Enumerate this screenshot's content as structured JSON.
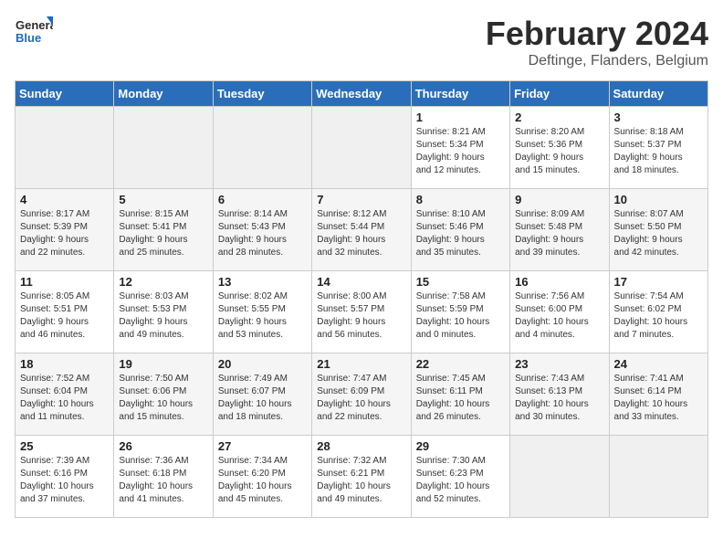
{
  "header": {
    "logo_text_general": "General",
    "logo_text_blue": "Blue",
    "month_year": "February 2024",
    "location": "Deftinge, Flanders, Belgium"
  },
  "weekdays": [
    "Sunday",
    "Monday",
    "Tuesday",
    "Wednesday",
    "Thursday",
    "Friday",
    "Saturday"
  ],
  "weeks": [
    [
      {
        "day": "",
        "data": ""
      },
      {
        "day": "",
        "data": ""
      },
      {
        "day": "",
        "data": ""
      },
      {
        "day": "",
        "data": ""
      },
      {
        "day": "1",
        "data": "Sunrise: 8:21 AM\nSunset: 5:34 PM\nDaylight: 9 hours\nand 12 minutes."
      },
      {
        "day": "2",
        "data": "Sunrise: 8:20 AM\nSunset: 5:36 PM\nDaylight: 9 hours\nand 15 minutes."
      },
      {
        "day": "3",
        "data": "Sunrise: 8:18 AM\nSunset: 5:37 PM\nDaylight: 9 hours\nand 18 minutes."
      }
    ],
    [
      {
        "day": "4",
        "data": "Sunrise: 8:17 AM\nSunset: 5:39 PM\nDaylight: 9 hours\nand 22 minutes."
      },
      {
        "day": "5",
        "data": "Sunrise: 8:15 AM\nSunset: 5:41 PM\nDaylight: 9 hours\nand 25 minutes."
      },
      {
        "day": "6",
        "data": "Sunrise: 8:14 AM\nSunset: 5:43 PM\nDaylight: 9 hours\nand 28 minutes."
      },
      {
        "day": "7",
        "data": "Sunrise: 8:12 AM\nSunset: 5:44 PM\nDaylight: 9 hours\nand 32 minutes."
      },
      {
        "day": "8",
        "data": "Sunrise: 8:10 AM\nSunset: 5:46 PM\nDaylight: 9 hours\nand 35 minutes."
      },
      {
        "day": "9",
        "data": "Sunrise: 8:09 AM\nSunset: 5:48 PM\nDaylight: 9 hours\nand 39 minutes."
      },
      {
        "day": "10",
        "data": "Sunrise: 8:07 AM\nSunset: 5:50 PM\nDaylight: 9 hours\nand 42 minutes."
      }
    ],
    [
      {
        "day": "11",
        "data": "Sunrise: 8:05 AM\nSunset: 5:51 PM\nDaylight: 9 hours\nand 46 minutes."
      },
      {
        "day": "12",
        "data": "Sunrise: 8:03 AM\nSunset: 5:53 PM\nDaylight: 9 hours\nand 49 minutes."
      },
      {
        "day": "13",
        "data": "Sunrise: 8:02 AM\nSunset: 5:55 PM\nDaylight: 9 hours\nand 53 minutes."
      },
      {
        "day": "14",
        "data": "Sunrise: 8:00 AM\nSunset: 5:57 PM\nDaylight: 9 hours\nand 56 minutes."
      },
      {
        "day": "15",
        "data": "Sunrise: 7:58 AM\nSunset: 5:59 PM\nDaylight: 10 hours\nand 0 minutes."
      },
      {
        "day": "16",
        "data": "Sunrise: 7:56 AM\nSunset: 6:00 PM\nDaylight: 10 hours\nand 4 minutes."
      },
      {
        "day": "17",
        "data": "Sunrise: 7:54 AM\nSunset: 6:02 PM\nDaylight: 10 hours\nand 7 minutes."
      }
    ],
    [
      {
        "day": "18",
        "data": "Sunrise: 7:52 AM\nSunset: 6:04 PM\nDaylight: 10 hours\nand 11 minutes."
      },
      {
        "day": "19",
        "data": "Sunrise: 7:50 AM\nSunset: 6:06 PM\nDaylight: 10 hours\nand 15 minutes."
      },
      {
        "day": "20",
        "data": "Sunrise: 7:49 AM\nSunset: 6:07 PM\nDaylight: 10 hours\nand 18 minutes."
      },
      {
        "day": "21",
        "data": "Sunrise: 7:47 AM\nSunset: 6:09 PM\nDaylight: 10 hours\nand 22 minutes."
      },
      {
        "day": "22",
        "data": "Sunrise: 7:45 AM\nSunset: 6:11 PM\nDaylight: 10 hours\nand 26 minutes."
      },
      {
        "day": "23",
        "data": "Sunrise: 7:43 AM\nSunset: 6:13 PM\nDaylight: 10 hours\nand 30 minutes."
      },
      {
        "day": "24",
        "data": "Sunrise: 7:41 AM\nSunset: 6:14 PM\nDaylight: 10 hours\nand 33 minutes."
      }
    ],
    [
      {
        "day": "25",
        "data": "Sunrise: 7:39 AM\nSunset: 6:16 PM\nDaylight: 10 hours\nand 37 minutes."
      },
      {
        "day": "26",
        "data": "Sunrise: 7:36 AM\nSunset: 6:18 PM\nDaylight: 10 hours\nand 41 minutes."
      },
      {
        "day": "27",
        "data": "Sunrise: 7:34 AM\nSunset: 6:20 PM\nDaylight: 10 hours\nand 45 minutes."
      },
      {
        "day": "28",
        "data": "Sunrise: 7:32 AM\nSunset: 6:21 PM\nDaylight: 10 hours\nand 49 minutes."
      },
      {
        "day": "29",
        "data": "Sunrise: 7:30 AM\nSunset: 6:23 PM\nDaylight: 10 hours\nand 52 minutes."
      },
      {
        "day": "",
        "data": ""
      },
      {
        "day": "",
        "data": ""
      }
    ]
  ]
}
